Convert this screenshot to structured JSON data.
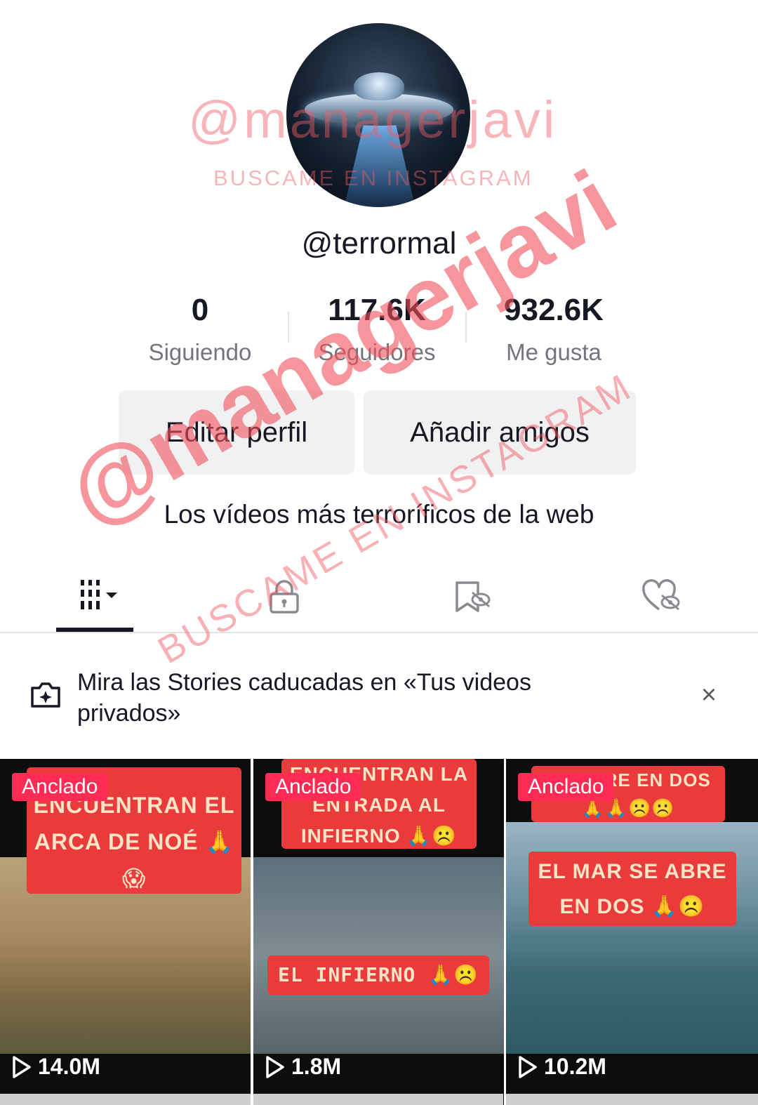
{
  "profile": {
    "username": "@terrormal",
    "bio": "Los vídeos más terroríficos de la web"
  },
  "stats": [
    {
      "value": "0",
      "label": "Siguiendo"
    },
    {
      "value": "117.6K",
      "label": "Seguidores"
    },
    {
      "value": "932.6K",
      "label": "Me gusta"
    }
  ],
  "buttons": {
    "edit": "Editar perfil",
    "add_friends": "Añadir amigos"
  },
  "tabs": [
    {
      "icon": "videos-grid-icon",
      "active": true
    },
    {
      "icon": "lock-icon",
      "active": false
    },
    {
      "icon": "saved-hidden-icon",
      "active": false
    },
    {
      "icon": "liked-hidden-icon",
      "active": false
    }
  ],
  "banner": {
    "text": "Mira las Stories caducadas en «Tus videos privados»",
    "icon": "camera-sparkle-icon",
    "close_icon": "close-icon"
  },
  "videos": [
    {
      "badge": "Anclado",
      "caption": "ENCUENTRAN EL ARCA DE NOÉ 🙏😱",
      "views": "14.0M"
    },
    {
      "badge": "Anclado",
      "caption": "ENCUENTRAN LA ENTRADA AL INFIERNO 🙏☹️",
      "caption2": "EL INFIERNO 🙏☹️",
      "views": "1.8M"
    },
    {
      "badge": "Anclado",
      "caption": "SE ABRE EN DOS 🙏🙏☹️☹️",
      "caption2": "EL MAR SE ABRE EN DOS 🙏☹️",
      "views": "10.2M"
    }
  ],
  "watermark": {
    "handle": "@managerjavi",
    "subtitle": "BUSCAME EN INSTAGRAM"
  },
  "colors": {
    "accent": "#fe2c55",
    "caption_bg": "#e93b3b",
    "secondary_text": "#73757c"
  }
}
